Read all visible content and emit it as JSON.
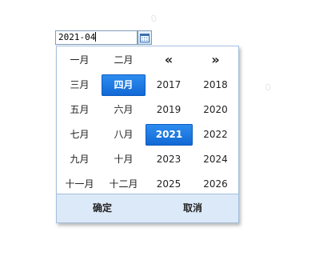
{
  "input": {
    "value": "2021-04"
  },
  "picker": {
    "rows": [
      [
        "一月",
        "二月",
        "«",
        "»"
      ],
      [
        "三月",
        "四月",
        "2017",
        "2018"
      ],
      [
        "五月",
        "六月",
        "2019",
        "2020"
      ],
      [
        "七月",
        "八月",
        "2021",
        "2022"
      ],
      [
        "九月",
        "十月",
        "2023",
        "2024"
      ],
      [
        "十一月",
        "十二月",
        "2025",
        "2026"
      ]
    ],
    "selected_month": "四月",
    "selected_year": "2021",
    "confirm_label": "确定",
    "cancel_label": "取消"
  },
  "background_marks": [
    "0",
    "0"
  ],
  "colors": {
    "selected": "#1a73e0",
    "footer": "#dce9f8",
    "border": "#a5c0de"
  },
  "icons": {
    "calendar_button": "calendar-icon",
    "prev": "double-chevron-left",
    "next": "double-chevron-right"
  }
}
